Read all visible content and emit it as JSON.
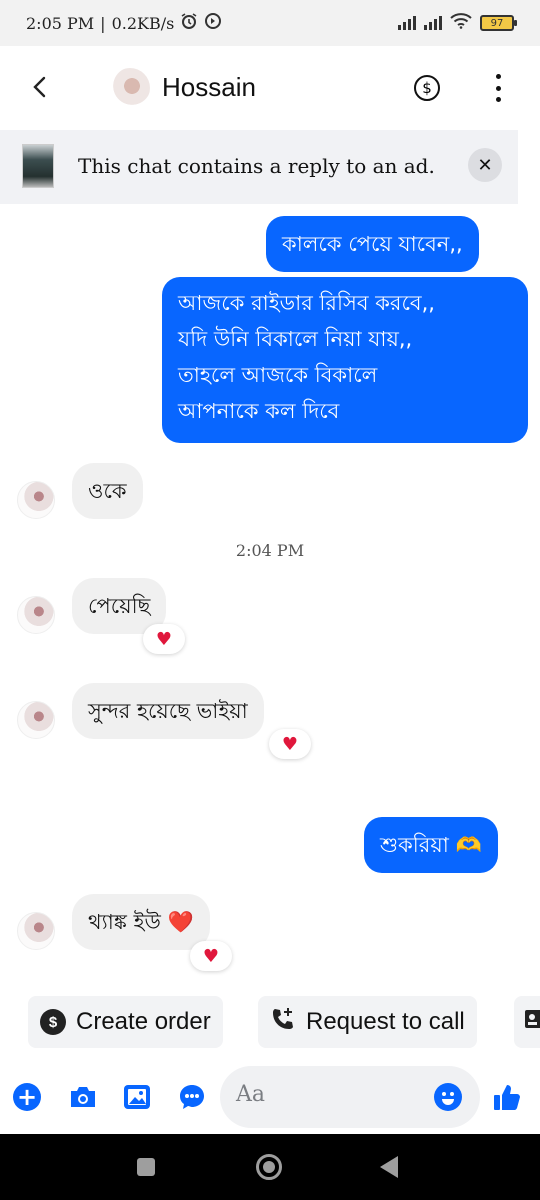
{
  "status_bar": {
    "time": "2:05 PM",
    "speed": "0.2KB/s",
    "battery": "97"
  },
  "header": {
    "contact_name": "Hossain",
    "dollar_icon_glyph": "$"
  },
  "ad_banner": {
    "text": "This chat contains a reply to an ad.",
    "close_glyph": "✕"
  },
  "messages": {
    "out1": "কালকে পেয়ে যাবেন,,",
    "out2_lines": [
      "আজকে রাইডার রিসিব করবে,,",
      "যদি উনি বিকালে নিয়া যায়,,",
      "তাহলে আজকে বিকালে",
      "আপনাকে কল দিবে"
    ],
    "in1": "ওকে",
    "timestamp": "2:04 PM",
    "in2": "পেয়েছি",
    "in3": "সুন্দর হয়েছে ভাইয়া",
    "out3": "শুকরিয়া 🫶",
    "in4": "থ্যাঙ্ক ইউ ❤️",
    "reaction_heart": "♥"
  },
  "actions": {
    "create_order": "Create order",
    "request_to_call": "Request to call"
  },
  "composer": {
    "placeholder": "Aa",
    "plus_glyph": "+"
  },
  "colors": {
    "accent": "#0866ff",
    "incoming_bubble": "#f0f0f0",
    "heart": "#e0173c"
  }
}
